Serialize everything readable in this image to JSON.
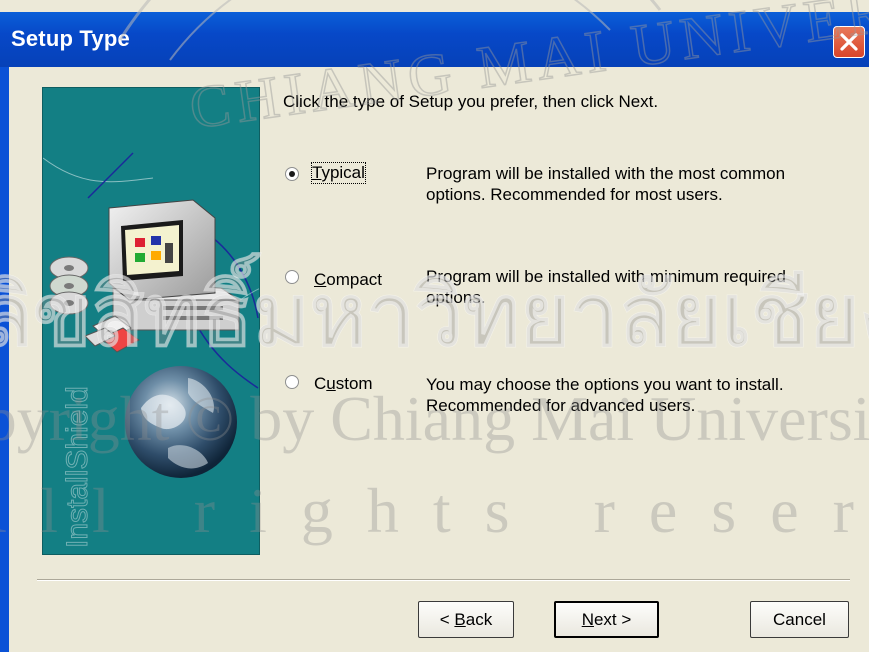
{
  "window": {
    "title": "Setup Type"
  },
  "icons": {
    "close": "close-icon",
    "banner": "installshield-computer-globe-art"
  },
  "banner_text": "InstallShield",
  "prompt": "Click the type of Setup you prefer, then click Next.",
  "options": [
    {
      "label": "Typical",
      "mnemonic": "T",
      "rest": "ypical",
      "selected": true,
      "description": "Program will be installed with the most common options.  Recommended for most users."
    },
    {
      "label": "Compact",
      "mnemonic": "C",
      "rest": "ompact",
      "selected": false,
      "description": "Program will be installed with minimum required options."
    },
    {
      "label": "Custom",
      "mnemonic": "u",
      "pre": "C",
      "rest": "stom",
      "selected": false,
      "description": "You may choose the options you want to install. Recommended for advanced users."
    }
  ],
  "buttons": {
    "back": {
      "label": "< Back",
      "prefix": "< ",
      "mnemonic": "B",
      "rest": "ack"
    },
    "next": {
      "label": "Next >",
      "mnemonic": "N",
      "rest": "ext >"
    },
    "cancel": {
      "label": "Cancel"
    }
  },
  "watermark": {
    "line1": "ลิขสิทธิ์มหาวิทยาลัยเชียงใหม่",
    "line2": "Copyright © by Chiang Mai University",
    "line3": "All rights reserved",
    "seal_text": "CHIANG MAI UNIVERSITY"
  }
}
